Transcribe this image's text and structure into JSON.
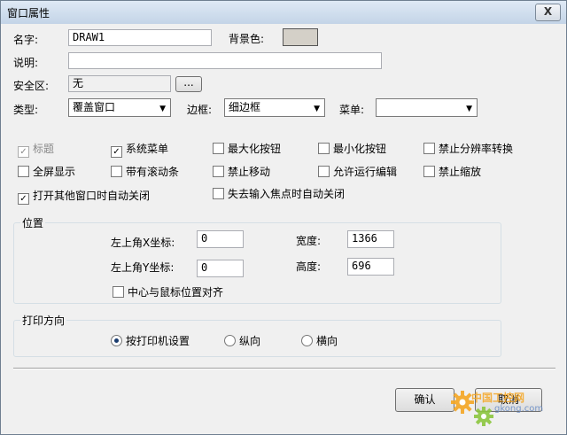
{
  "window": {
    "title": "窗口属性",
    "close_glyph": "X"
  },
  "name": {
    "label": "名字:",
    "value": "DRAW1"
  },
  "bgcolor": {
    "label": "背景色:",
    "color": "#d4d0c8"
  },
  "desc": {
    "label": "说明:",
    "value": ""
  },
  "safe": {
    "label": "安全区:",
    "value": "无",
    "button": "..."
  },
  "type": {
    "label": "类型:",
    "value": "覆盖窗口"
  },
  "border": {
    "label": "边框:",
    "value": "细边框"
  },
  "menu": {
    "label": "菜单:",
    "value": ""
  },
  "options": [
    {
      "label": "标题",
      "checked": true,
      "disabled": true
    },
    {
      "label": "系统菜单",
      "checked": true
    },
    {
      "label": "最大化按钮",
      "checked": false
    },
    {
      "label": "最小化按钮",
      "checked": false
    },
    {
      "label": "禁止分辨率转换",
      "checked": false
    },
    {
      "label": "全屏显示",
      "checked": false
    },
    {
      "label": "带有滚动条",
      "checked": false
    },
    {
      "label": "禁止移动",
      "checked": false
    },
    {
      "label": "允许运行编辑",
      "checked": false
    },
    {
      "label": "禁止缩放",
      "checked": false
    },
    {
      "label": "打开其他窗口时自动关闭",
      "checked": true
    },
    {
      "label": "失去输入焦点时自动关闭",
      "checked": false
    }
  ],
  "position": {
    "title": "位置",
    "x_label": "左上角X坐标:",
    "x_value": "0",
    "y_label": "左上角Y坐标:",
    "y_value": "0",
    "w_label": "宽度:",
    "w_value": "1366",
    "h_label": "高度:",
    "h_value": "696",
    "center_label": "中心与鼠标位置对齐",
    "center_checked": false
  },
  "print": {
    "title": "打印方向",
    "options": [
      {
        "label": "按打印机设置",
        "selected": true
      },
      {
        "label": "纵向",
        "selected": false
      },
      {
        "label": "横向",
        "selected": false
      }
    ]
  },
  "buttons": {
    "ok": "确认",
    "cancel": "取消"
  },
  "watermark": {
    "text": "中国工控网",
    "url": "gkong.com"
  }
}
